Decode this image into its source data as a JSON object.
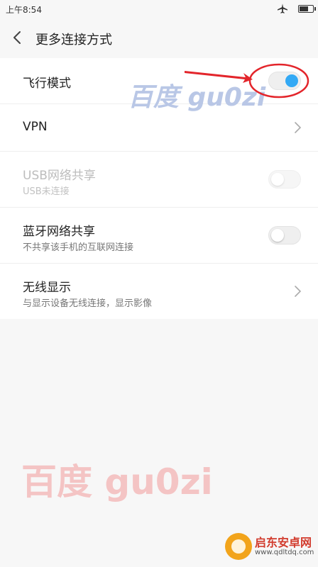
{
  "status_bar": {
    "time": "上午8:54"
  },
  "header": {
    "title": "更多连接方式"
  },
  "rows": [
    {
      "label": "飞行模式",
      "switch_on": true
    },
    {
      "label": "VPN"
    },
    {
      "label": "USB网络共享",
      "sub": "USB未连接",
      "switch_on": false,
      "enabled": false
    },
    {
      "label": "蓝牙网络共享",
      "sub": "不共享该手机的互联网连接",
      "switch_on": false
    },
    {
      "label": "无线显示",
      "sub": "与显示设备无线连接，显示影像"
    }
  ],
  "watermarks": {
    "top": "百度 gu0zi",
    "bottom": "百度  gu0zi"
  },
  "corner_logo": {
    "brand": "启东安卓网",
    "site": "www.qdltdq.com"
  },
  "colors": {
    "accent": "#33a9f5",
    "annotation": "#e3252b"
  }
}
